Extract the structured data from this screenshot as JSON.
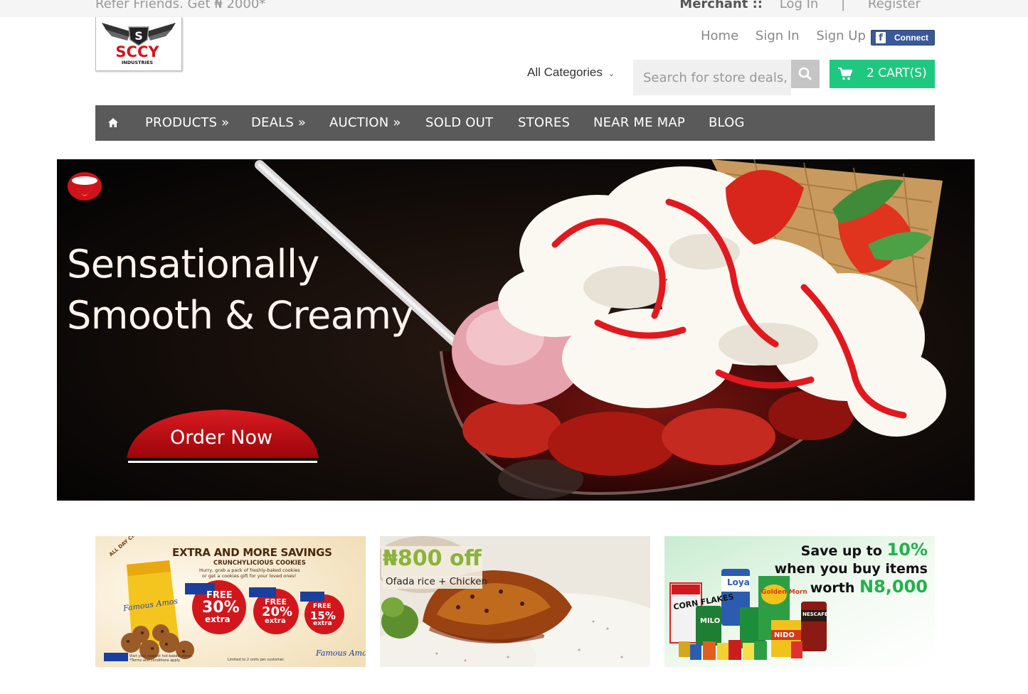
{
  "topbar": {
    "refer_text": "Refer Friends. Get ₦ 2000*",
    "merchant_label": "Merchant ::",
    "login_label": "Log In",
    "separator": "|",
    "register_label": "Register"
  },
  "logo": {
    "brand": "SCCY",
    "subtitle": "INDUSTRIES"
  },
  "header": {
    "home_label": "Home",
    "signin_label": "Sign In",
    "signup_label": "Sign Up",
    "fb_connect_label": "Connect",
    "categories_label": "All Categories",
    "search_placeholder": "Search for store deals,",
    "cart_label": "2 CART(S)"
  },
  "nav": {
    "items": [
      {
        "label": "PRODUCTS »"
      },
      {
        "label": "DEALS »"
      },
      {
        "label": "AUCTION »"
      },
      {
        "label": "SOLD OUT"
      },
      {
        "label": "STORES"
      },
      {
        "label": "NEAR ME MAP"
      },
      {
        "label": "BLOG"
      }
    ]
  },
  "hero": {
    "line1": "Sensationally",
    "line2": "Smooth & Creamy",
    "cta_label": "Order Now"
  },
  "banners": {
    "cookies": {
      "headline": "EXTRA AND MORE SAVINGS",
      "subhead": "CRUNCHYLICIOUS COOKIES",
      "body_line1": "Hurry, grab a pack of freshly-baked cookies",
      "body_line2": "or get a cookies gift for your loved ones!",
      "arc_text": "ALL DAY CRUNCH!",
      "brand": "Famous Amos",
      "offers": [
        {
          "free": "FREE",
          "pct": "30%",
          "extra": "extra"
        },
        {
          "free": "FREE",
          "pct": "20%",
          "extra": "extra"
        },
        {
          "free": "FREE",
          "pct": "15%",
          "extra": "extra"
        }
      ],
      "footer_left": "Visit your nearest hot-baked stores.",
      "footer_terms": "*Terms and conditions apply.",
      "footer_right": "Limited to 2 units per customer."
    },
    "food": {
      "offer": "₦800 off",
      "dish": "Ofada rice + Chicken"
    },
    "grocery": {
      "line1_prefix": "Save up to",
      "line1_value": "10%",
      "line2": "when you buy items",
      "line3_prefix": "worth",
      "line3_value": "N8,000",
      "products": [
        "CORN FLAKES",
        "Loya",
        "MILO",
        "Golden Morn",
        "NIDO",
        "NESCAFE"
      ]
    }
  },
  "colors": {
    "accent_green": "#1fc87f",
    "nav_bg": "#5a5a5a",
    "facebook": "#3b5998",
    "cta_red": "#c0090f",
    "promo_green": "#22b14c"
  }
}
